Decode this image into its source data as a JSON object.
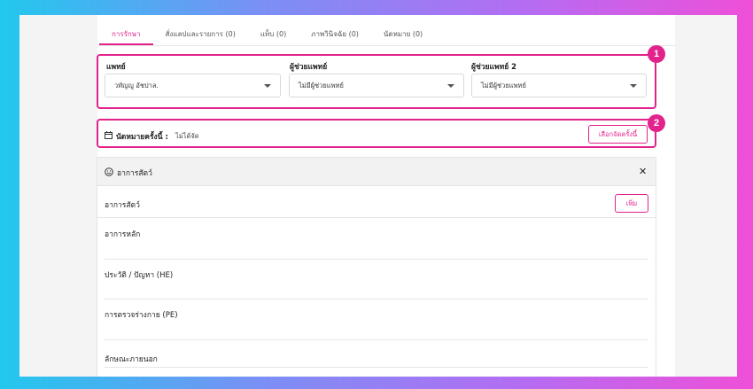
{
  "tabs": [
    {
      "label": "การรักษา"
    },
    {
      "label": "สั่งแลปและรายการ (0)"
    },
    {
      "label": "แท็บ (0)"
    },
    {
      "label": "ภาพวินิจฉัย (0)"
    },
    {
      "label": "นัดหมาย (0)"
    }
  ],
  "doctor": {
    "label": "แพทย์",
    "value": "วทัญญู อัชปาล."
  },
  "assistant1": {
    "label": "ผู้ช่วยแพทย์",
    "value": "ไม่มีผู้ช่วยแพทย์"
  },
  "assistant2": {
    "label": "ผู้ช่วยแพทย์ 2",
    "value": "ไม่มีผู้ช่วยแพทย์"
  },
  "appointment": {
    "label": "นัดหมายครั้งนี้ :",
    "value": "ไม่ได้จัด",
    "button": "เลือกจัดครั้งนี้"
  },
  "badges": {
    "one": "1",
    "two": "2"
  },
  "symptoms": {
    "header": "อาการสัตว์",
    "close": "✕",
    "subheader": "อาการสัตว์",
    "add_button": "เพิ่ม",
    "rows": [
      {
        "title": "อาการหลัก"
      },
      {
        "title": "ประวัติ / ปัญหา (HE)"
      },
      {
        "title": "การตรวจร่างกาย (PE)"
      },
      {
        "title": "ลักษณะภายนอก"
      }
    ]
  },
  "colors": {
    "accent": "#e2238c"
  }
}
